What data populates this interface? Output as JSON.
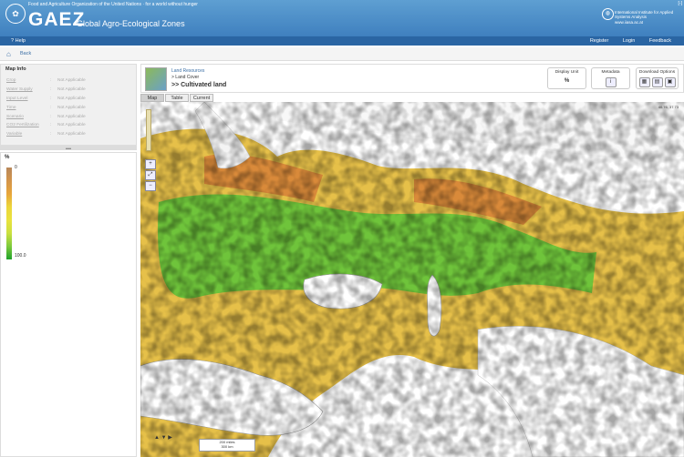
{
  "header": {
    "fao_line": "Food and Agriculture Organization of the United Nations  ·  for a world without hunger",
    "title": "GAEZ",
    "subtitle": "Global Agro-Ecological Zones",
    "iiasa_name": "International Institute for Applied Systems Analysis",
    "iiasa_url": "www.iiasa.ac.at",
    "corner_label": "[-]"
  },
  "nav": {
    "help": "Help",
    "links": [
      "Register",
      "Login",
      "Feedback"
    ],
    "back": "Back"
  },
  "map_info": {
    "title": "Map Info",
    "rows": [
      {
        "label": "Crop",
        "value": "Not Applicable"
      },
      {
        "label": "Water Supply",
        "value": "Not Applicable"
      },
      {
        "label": "Input Level",
        "value": "Not Applicable"
      },
      {
        "label": "Time",
        "value": "Not Applicable"
      },
      {
        "label": "Scenario",
        "value": "Not Applicable"
      },
      {
        "label": "CO2 Fertilization",
        "value": "Not Applicable"
      },
      {
        "label": "Variable",
        "value": "Not Applicable"
      }
    ]
  },
  "legend": {
    "title": "%",
    "max": "0",
    "min": "100.0",
    "colors": [
      "#b8875a",
      "#e7a53b",
      "#e9e23e",
      "#7dca3c",
      "#20a22a"
    ]
  },
  "breadcrumb": {
    "level1": "Land Resources",
    "level2": "> Land Cover",
    "level3": ">> Cultivated land"
  },
  "display_unit": {
    "label": "Display Unit",
    "value": "%"
  },
  "metadata": {
    "label": "Metadata"
  },
  "download": {
    "label": "Download Options"
  },
  "tabs": [
    "Map",
    "Table",
    "Current"
  ],
  "map": {
    "coords": "40.76, 37.73",
    "scale_top": "200 miles",
    "scale_bottom": "300 km"
  }
}
